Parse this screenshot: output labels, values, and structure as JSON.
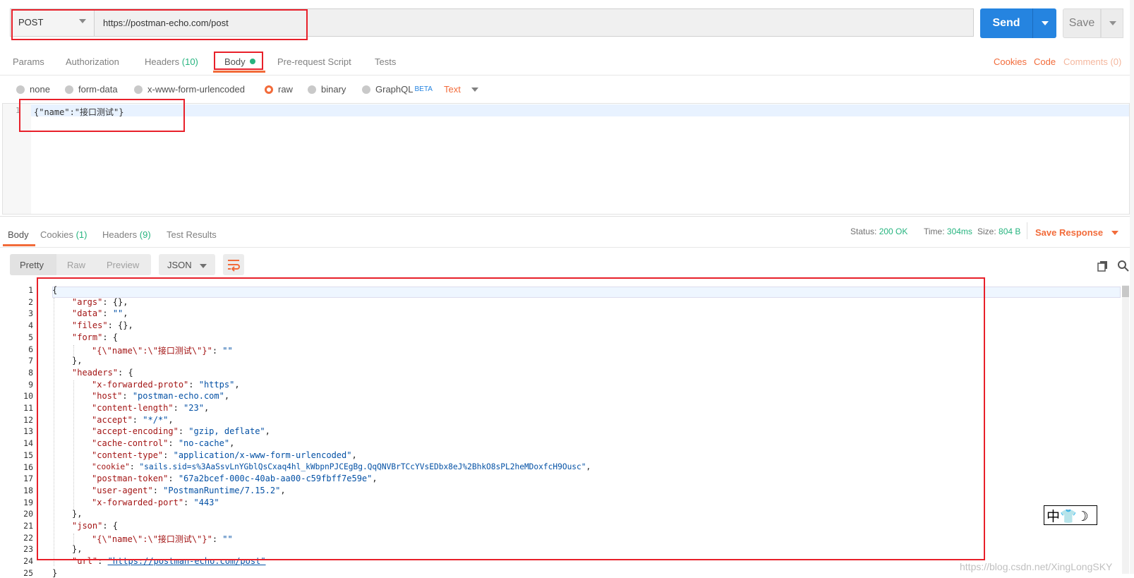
{
  "request": {
    "method": "POST",
    "url": "https://postman-echo.com/post",
    "send_label": "Send",
    "save_label": "Save"
  },
  "request_tabs": {
    "params": "Params",
    "authorization": "Authorization",
    "headers": "Headers",
    "headers_count": "(10)",
    "body": "Body",
    "pre_request": "Pre-request Script",
    "tests": "Tests",
    "cookies": "Cookies",
    "code": "Code",
    "comments": "Comments (0)"
  },
  "body_types": {
    "none": "none",
    "form_data": "form-data",
    "urlencoded": "x-www-form-urlencoded",
    "raw": "raw",
    "binary": "binary",
    "graphql": "GraphQL",
    "beta": "BETA",
    "selected": "raw",
    "content_type": "Text"
  },
  "request_body": {
    "line_number": "1",
    "text": "{\"name\":\"接口测试\"}"
  },
  "response_tabs": {
    "body": "Body",
    "cookies": "Cookies",
    "cookies_count": "(1)",
    "headers": "Headers",
    "headers_count": "(9)",
    "test_results": "Test Results"
  },
  "response_meta": {
    "status_label": "Status:",
    "status_value": "200 OK",
    "time_label": "Time:",
    "time_value": "304ms",
    "size_label": "Size:",
    "size_value": "804 B",
    "save_response": "Save Response"
  },
  "response_view": {
    "pretty": "Pretty",
    "raw": "Raw",
    "preview": "Preview",
    "format": "JSON"
  },
  "response_body": {
    "line_numbers": [
      "1",
      "2",
      "3",
      "4",
      "5",
      "6",
      "7",
      "8",
      "9",
      "10",
      "11",
      "12",
      "13",
      "14",
      "15",
      "16",
      "17",
      "18",
      "19",
      "20",
      "21",
      "22",
      "23",
      "24",
      "25"
    ],
    "lines": {
      "l1": "{",
      "l2_key": "\"args\"",
      "l2_val": ": {},",
      "l3_key": "\"data\"",
      "l3_sep": ": ",
      "l3_val": "\"\"",
      "l3_end": ",",
      "l4_key": "\"files\"",
      "l4_val": ": {},",
      "l5_key": "\"form\"",
      "l5_val": ": {",
      "l6_key": "\"{\\\"name\\\":\\\"接口测试\\\"}\"",
      "l6_sep": ": ",
      "l6_val": "\"\"",
      "l7": "},",
      "l8_key": "\"headers\"",
      "l8_val": ": {",
      "l9_key": "\"x-forwarded-proto\"",
      "l9_val": "\"https\"",
      "l10_key": "\"host\"",
      "l10_val": "\"postman-echo.com\"",
      "l11_key": "\"content-length\"",
      "l11_val": "\"23\"",
      "l12_key": "\"accept\"",
      "l12_val": "\"*/*\"",
      "l13_key": "\"accept-encoding\"",
      "l13_val": "\"gzip, deflate\"",
      "l14_key": "\"cache-control\"",
      "l14_val": "\"no-cache\"",
      "l15_key": "\"content-type\"",
      "l15_val": "\"application/x-www-form-urlencoded\"",
      "l16_key": "\"cookie\"",
      "l16_val": "\"sails.sid=s%3AaSsvLnYGblQsCxaq4hl_kWbpnPJCEgBg.QqQNVBrTCcYVsEDbx8eJ%2BhkO8sPL2heMDoxfcH9Ousc\"",
      "l17_key": "\"postman-token\"",
      "l17_val": "\"67a2bcef-000c-40ab-aa00-c59fbff7e59e\"",
      "l18_key": "\"user-agent\"",
      "l18_val": "\"PostmanRuntime/7.15.2\"",
      "l19_key": "\"x-forwarded-port\"",
      "l19_val": "\"443\"",
      "l20": "},",
      "l21_key": "\"json\"",
      "l21_val": ": {",
      "l22_key": "\"{\\\"name\\\":\\\"接口测试\\\"}\"",
      "l22_sep": ": ",
      "l22_val": "\"\"",
      "l23": "},",
      "l24_key": "\"url\"",
      "l24_sep": ": ",
      "l24_val": "\"https://postman-echo.com/post\"",
      "l25": "}"
    }
  },
  "ime_indicator": "中👕☽",
  "watermark": "https://blog.csdn.net/XingLongSKY",
  "colors": {
    "accent": "#f26b3a",
    "send": "#2584e0",
    "success": "#26b47f",
    "annotation": "#e8202a"
  }
}
